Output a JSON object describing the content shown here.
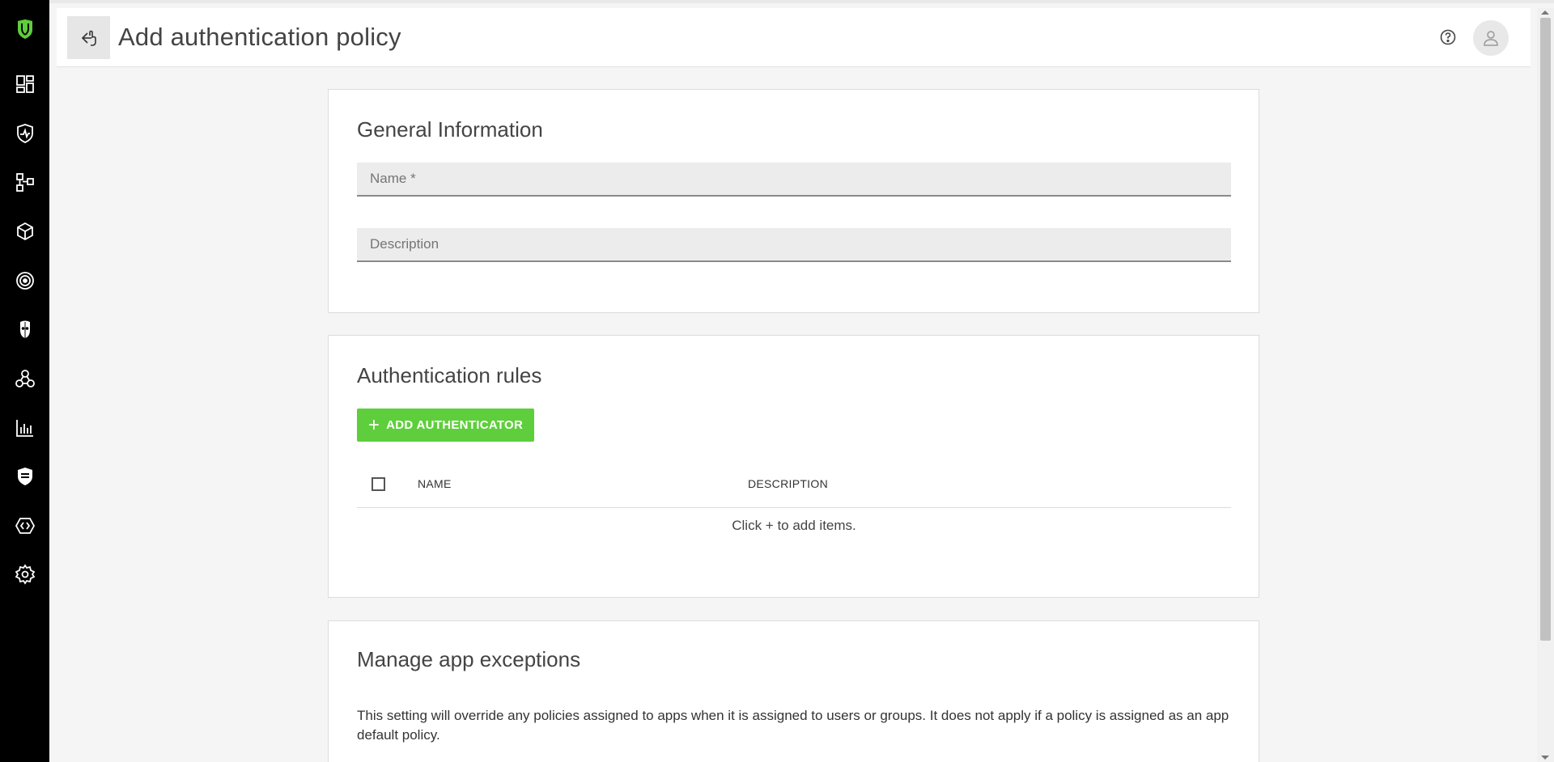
{
  "header": {
    "title": "Add authentication policy"
  },
  "sidebar": {
    "items": [
      {
        "name": "logo",
        "icon": "shield-logo-icon"
      },
      {
        "name": "dashboard",
        "icon": "dashboard-icon"
      },
      {
        "name": "security",
        "icon": "shield-pulse-icon"
      },
      {
        "name": "network",
        "icon": "network-nodes-icon"
      },
      {
        "name": "packages",
        "icon": "cube-icon"
      },
      {
        "name": "targeting",
        "icon": "target-icon"
      },
      {
        "name": "threats",
        "icon": "mask-icon"
      },
      {
        "name": "integrations",
        "icon": "webhook-icon"
      },
      {
        "name": "reports",
        "icon": "bar-chart-icon"
      },
      {
        "name": "policies",
        "icon": "shield-list-icon"
      },
      {
        "name": "api",
        "icon": "code-badge-icon"
      },
      {
        "name": "settings",
        "icon": "gear-icon"
      }
    ]
  },
  "general": {
    "title": "General Information",
    "name_placeholder": "Name *",
    "name_value": "",
    "description_placeholder": "Description",
    "description_value": ""
  },
  "rules": {
    "title": "Authentication rules",
    "add_button_label": "ADD AUTHENTICATOR",
    "columns": [
      "NAME",
      "DESCRIPTION"
    ],
    "empty_text": "Click + to add items."
  },
  "exceptions": {
    "title": "Manage app exceptions",
    "note": "This setting will override any policies assigned to apps when it is assigned to users or groups. It does not apply if a policy is assigned as an app default policy."
  },
  "colors": {
    "accent": "#5fce3c",
    "sidebar_bg": "#000000",
    "logo_green": "#5fce3c"
  }
}
